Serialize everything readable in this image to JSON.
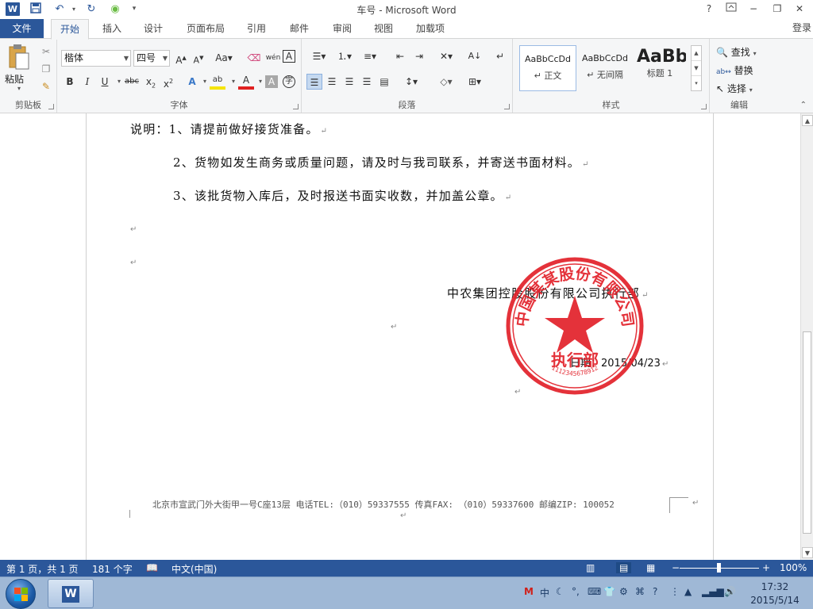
{
  "titlebar": {
    "title": "车号 - Microsoft Word",
    "controls": {
      "help": "?",
      "minimize": "−",
      "restore": "❐",
      "close": "✕"
    }
  },
  "tabs": {
    "file": "文件",
    "items": [
      "开始",
      "插入",
      "设计",
      "页面布局",
      "引用",
      "邮件",
      "审阅",
      "视图",
      "加载项"
    ],
    "active": "开始",
    "login": "登录"
  },
  "ribbon": {
    "clipboard": {
      "label": "剪贴板",
      "paste": "粘贴"
    },
    "font": {
      "label": "字体",
      "font_name": "楷体",
      "font_size": "四号"
    },
    "paragraph": {
      "label": "段落"
    },
    "styles": {
      "label": "样式",
      "items": [
        {
          "sample": "AaBbCcDd",
          "name": "↵ 正文"
        },
        {
          "sample": "AaBbCcDd",
          "name": "↵ 无间隔"
        },
        {
          "sample": "AaBb",
          "name": "标题 1"
        }
      ]
    },
    "editing": {
      "label": "编辑",
      "find": "查找",
      "replace": "替换",
      "select": "选择"
    }
  },
  "document": {
    "lines": [
      "说明：1、请提前做好接货准备。",
      "2、货物如发生商务或质量问题，请及时与我司联系，并寄送书面材料。",
      "3、该批货物入库后，及时报送书面实收数，并加盖公章。"
    ],
    "signature": "中农集团控股股份有限公司执行部",
    "date": "日期：2015/04/23",
    "footer": "北京市宣武门外大街甲一号C座13层  电话TEL:（010）59337555 传真FAX: （010）59337600 邮编ZIP: 100052",
    "stamp": {
      "arc_text": "中国某某股份有限公司",
      "center_text": "执行部",
      "number": "1112345678912",
      "color": "#e3232c"
    }
  },
  "statusbar": {
    "page": "第 1 页，共 1 页",
    "words": "181 个字",
    "language": "中文(中国)",
    "zoom": "100%"
  },
  "taskbar": {
    "time": "17:32",
    "date": "2015/5/14"
  }
}
